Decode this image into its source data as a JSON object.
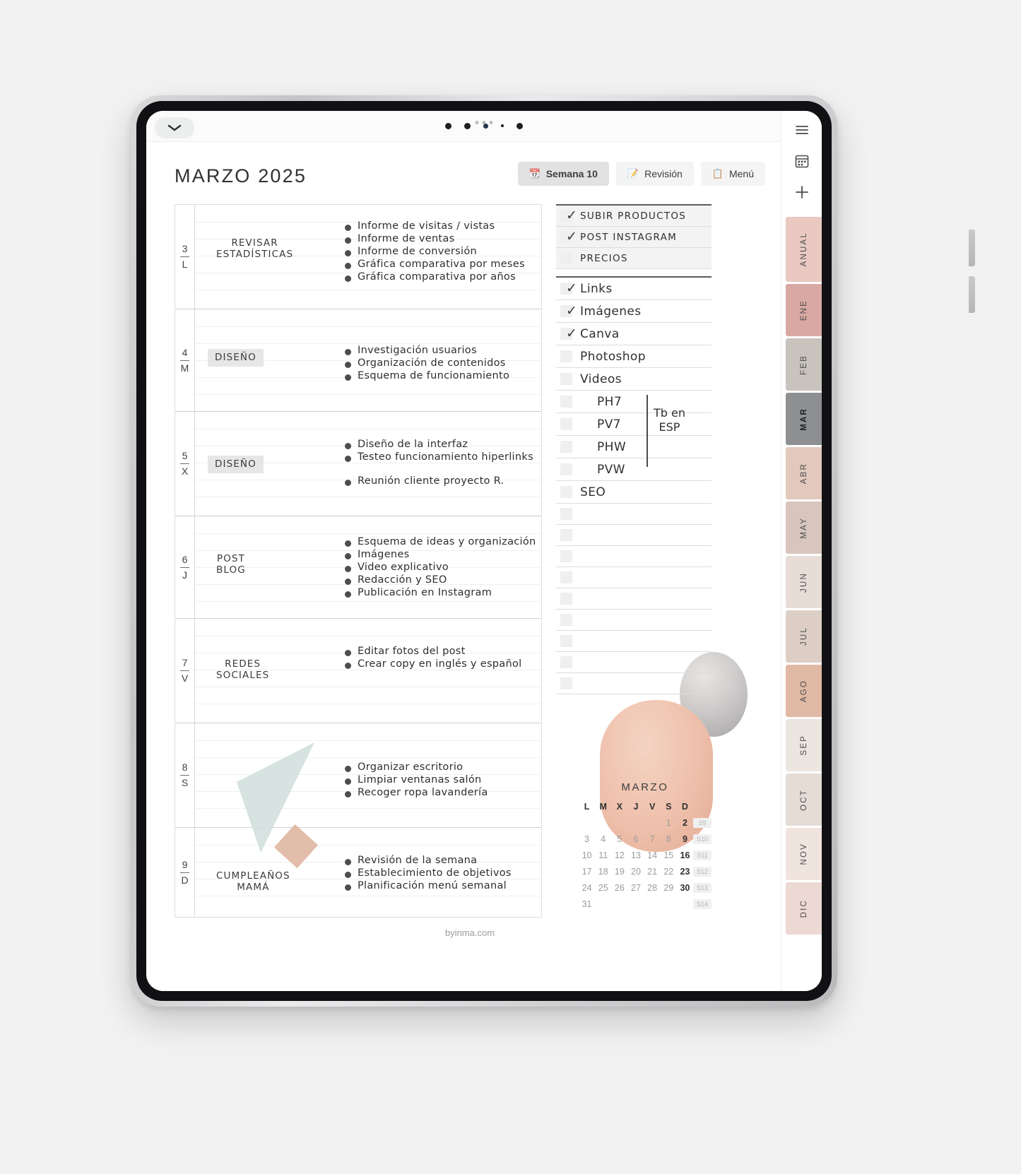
{
  "window": {
    "collapse_icon": "chevron-down-icon",
    "handle_icon": "drag-dots-icon"
  },
  "header": {
    "title": "MARZO 2025",
    "buttons": [
      {
        "label": "Semana 10",
        "icon": "calendar-week-icon",
        "active": true
      },
      {
        "label": "Revisión",
        "icon": "note-edit-icon",
        "active": false
      },
      {
        "label": "Menú",
        "icon": "list-menu-icon",
        "active": false
      }
    ]
  },
  "planner": {
    "days": [
      {
        "num": "3",
        "letter": "L",
        "category": "REVISAR\nESTADÍSTICAS",
        "highlight": false,
        "tasks": [
          "Informe de visitas / vistas",
          "Informe de ventas",
          "Informe de conversión",
          "Gráfica comparativa por meses",
          "Gráfica comparativa por años"
        ]
      },
      {
        "num": "4",
        "letter": "M",
        "category": "DISEÑO",
        "highlight": true,
        "tasks": [
          "Investigación usuarios",
          "Organización de contenidos",
          "Esquema de funcionamiento"
        ]
      },
      {
        "num": "5",
        "letter": "X",
        "category": "DISEÑO",
        "highlight": true,
        "tasks": [
          "Diseño de la interfaz",
          "Testeo funcionamiento hiperlinks",
          "Reunión cliente proyecto R."
        ]
      },
      {
        "num": "6",
        "letter": "J",
        "category": "POST\nBLOG",
        "highlight": false,
        "tasks": [
          "Esquema de ideas y organización",
          "Imágenes",
          "Video explicativo",
          "Redacción y SEO",
          "Publicación en Instagram"
        ]
      },
      {
        "num": "7",
        "letter": "V",
        "category": "REDES\nSOCIALES",
        "highlight": false,
        "tasks": [
          "Editar fotos del post",
          "Crear copy en inglés y español"
        ]
      },
      {
        "num": "8",
        "letter": "S",
        "category": "",
        "highlight": false,
        "tasks": [
          "Organizar escritorio",
          "Limpiar ventanas salón",
          "Recoger ropa lavandería"
        ]
      },
      {
        "num": "9",
        "letter": "D",
        "category": "CUMPLEAÑOS\nMAMÁ",
        "highlight": false,
        "tasks": [
          "Revisión de la semana",
          "Establecimiento de objetivos",
          "Planificación menú semanal"
        ]
      }
    ],
    "footer_url": "byinma.com"
  },
  "checklist": {
    "group_caps": [
      {
        "label": "SUBIR PRODUCTOS",
        "checked": true
      },
      {
        "label": "POST INSTAGRAM",
        "checked": true
      },
      {
        "label": "PRECIOS",
        "checked": false
      }
    ],
    "group_hand": [
      {
        "label": "Links",
        "checked": true,
        "indent": false
      },
      {
        "label": "Imágenes",
        "checked": true,
        "indent": false
      },
      {
        "label": "Canva",
        "checked": true,
        "indent": false
      },
      {
        "label": "Photoshop",
        "checked": false,
        "indent": false
      },
      {
        "label": "Videos",
        "checked": false,
        "indent": false
      },
      {
        "label": "PH7",
        "checked": false,
        "indent": true
      },
      {
        "label": "PV7",
        "checked": false,
        "indent": true
      },
      {
        "label": "PHW",
        "checked": false,
        "indent": true
      },
      {
        "label": "PVW",
        "checked": false,
        "indent": true
      },
      {
        "label": "SEO",
        "checked": false,
        "indent": false
      }
    ],
    "side_note": "Tb en\nESP",
    "empty_rows": 9
  },
  "mini_calendar": {
    "title": "MARZO",
    "weekday_headers": [
      "L",
      "M",
      "X",
      "J",
      "V",
      "S",
      "D"
    ],
    "weeks": [
      {
        "days": [
          "",
          "",
          "",
          "",
          "",
          "1",
          "2"
        ],
        "bold": [
          "2"
        ],
        "week_label": "S9"
      },
      {
        "days": [
          "3",
          "4",
          "5",
          "6",
          "7",
          "8",
          "9"
        ],
        "bold": [
          "9"
        ],
        "week_label": "S10"
      },
      {
        "days": [
          "10",
          "11",
          "12",
          "13",
          "14",
          "15",
          "16"
        ],
        "bold": [
          "16"
        ],
        "week_label": "S11"
      },
      {
        "days": [
          "17",
          "18",
          "19",
          "20",
          "21",
          "22",
          "23"
        ],
        "bold": [
          "23"
        ],
        "week_label": "S12"
      },
      {
        "days": [
          "24",
          "25",
          "26",
          "27",
          "28",
          "29",
          "30"
        ],
        "bold": [
          "30"
        ],
        "week_label": "S13"
      },
      {
        "days": [
          "31",
          "",
          "",
          "",
          "",
          "",
          ""
        ],
        "bold": [],
        "week_label": "S14"
      }
    ]
  },
  "rail": {
    "icons": [
      "hamburger-menu-icon",
      "calendar-grid-icon",
      "plus-icon",
      "calendar-add-icon"
    ],
    "tabs": [
      {
        "label": "ANUAL",
        "color": "#e9c9c2",
        "selected": false
      },
      {
        "label": "ENE",
        "color": "#d9a8a2",
        "selected": false
      },
      {
        "label": "FEB",
        "color": "#c9c3bd",
        "selected": false
      },
      {
        "label": "MAR",
        "color": "#8e8f91",
        "selected": true
      },
      {
        "label": "ABR",
        "color": "#e3c9bd",
        "selected": false
      },
      {
        "label": "MAY",
        "color": "#d8c6be",
        "selected": false
      },
      {
        "label": "JUN",
        "color": "#e8ddd6",
        "selected": false
      },
      {
        "label": "JUL",
        "color": "#ddcfc6",
        "selected": false
      },
      {
        "label": "AGO",
        "color": "#e0b9a4",
        "selected": false
      },
      {
        "label": "SEP",
        "color": "#ece6e0",
        "selected": false
      },
      {
        "label": "OCT",
        "color": "#e6dcd6",
        "selected": false
      },
      {
        "label": "NOV",
        "color": "#f0e4de",
        "selected": false
      },
      {
        "label": "DIC",
        "color": "#ecd9d4",
        "selected": false
      }
    ]
  }
}
